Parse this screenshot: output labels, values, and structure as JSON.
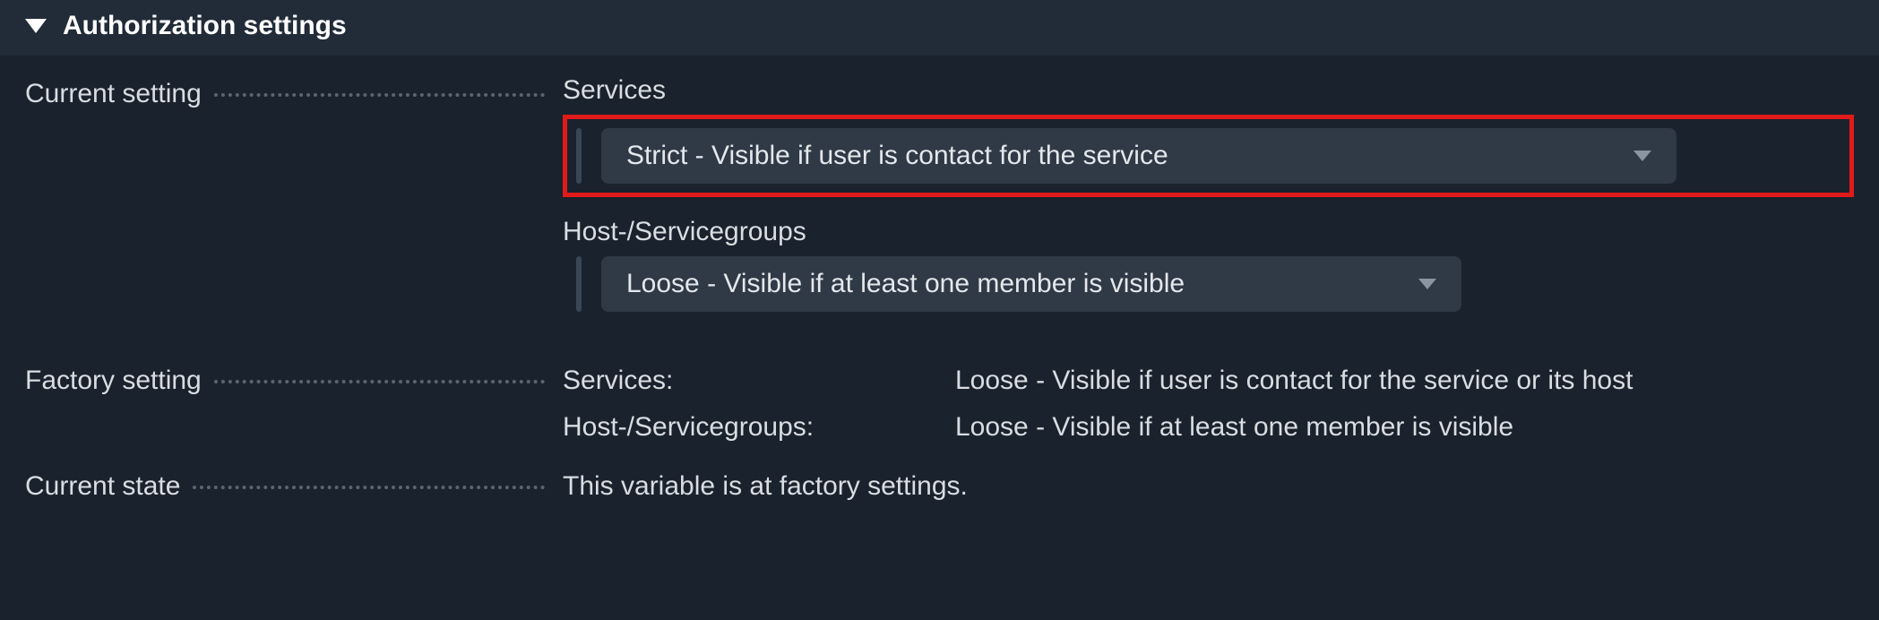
{
  "section": {
    "title": "Authorization settings"
  },
  "labels": {
    "current_setting": "Current setting",
    "factory_setting": "Factory setting",
    "current_state": "Current state"
  },
  "fields": {
    "services": {
      "label": "Services",
      "selected": "Strict - Visible if user is contact for the service"
    },
    "host_servicegroups": {
      "label": "Host-/Servicegroups",
      "selected": "Loose - Visible if at least one member is visible"
    }
  },
  "factory": {
    "services_key": "Services:",
    "services_value": "Loose - Visible if user is contact for the service or its host",
    "groups_key": "Host-/Servicegroups:",
    "groups_value": "Loose - Visible if at least one member is visible"
  },
  "state": {
    "text": "This variable is at factory settings."
  }
}
